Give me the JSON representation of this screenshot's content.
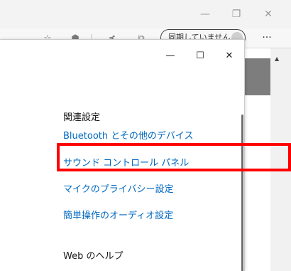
{
  "browser": {
    "titlebar": {
      "min_glyph": "—",
      "max_glyph": "❐",
      "close_glyph": "✕"
    },
    "toolbar": {
      "sync_label": "同期していません",
      "more_glyph": "···"
    }
  },
  "settings_window": {
    "titlebar": {
      "min_glyph": "—",
      "max_glyph": "☐",
      "close_glyph": "✕"
    },
    "related_settings": {
      "heading": "関連設定",
      "links": {
        "bluetooth": "Bluetooth とその他のデバイス",
        "sound_control_panel": "サウンド コントロール パネル",
        "mic_privacy": "マイクのプライバシー設定",
        "accessibility_audio": "簡単操作のオーディオ設定"
      }
    },
    "web_help": {
      "heading": "Web のヘルプ"
    }
  },
  "colors": {
    "link": "#0067c0",
    "highlight": "#ff0000"
  }
}
